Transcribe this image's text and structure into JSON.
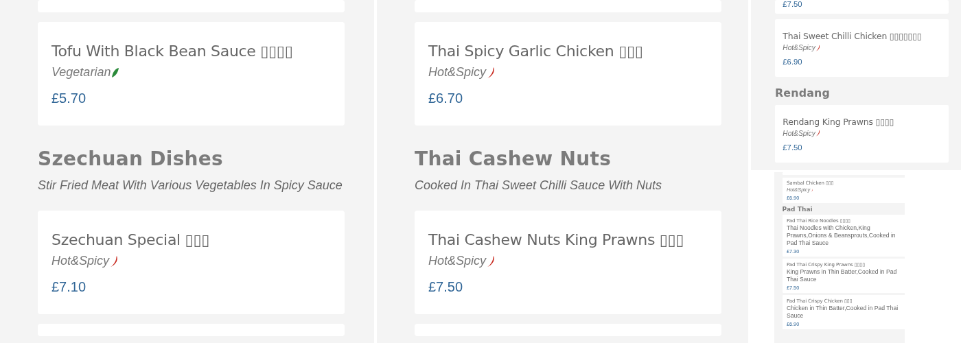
{
  "panels": [
    {
      "kind": "large",
      "items": [
        {
          "kind": "cut-card"
        },
        {
          "kind": "card",
          "name": "Tofu With Black Bean Sauce ▯▯▯▯",
          "tag": {
            "text": "Vegetarian",
            "kind": "leaf"
          },
          "price": "£5.70"
        },
        {
          "kind": "section",
          "title": "Szechuan Dishes",
          "subtitle": "Stir Fried Meat With Various Vegetables In Spicy Sauce"
        },
        {
          "kind": "card",
          "name": "Szechuan Special ▯▯▯",
          "tag": {
            "text": "Hot&Spicy",
            "kind": "chili"
          },
          "price": "£7.10"
        },
        {
          "kind": "cut-card"
        }
      ]
    },
    {
      "kind": "large",
      "items": [
        {
          "kind": "cut-card"
        },
        {
          "kind": "card",
          "name": "Thai Spicy Garlic Chicken ▯▯▯",
          "tag": {
            "text": "Hot&Spicy",
            "kind": "chili"
          },
          "price": "£6.70"
        },
        {
          "kind": "section",
          "title": "Thai Cashew Nuts",
          "subtitle": "Cooked In Thai Sweet Chilli Sauce With Nuts"
        },
        {
          "kind": "card",
          "name": "Thai Cashew Nuts King Prawns ▯▯▯",
          "tag": {
            "text": "Hot&Spicy",
            "kind": "chili"
          },
          "price": "£7.50"
        },
        {
          "kind": "cut-card"
        }
      ]
    },
    {
      "kind": "medium",
      "items": [
        {
          "kind": "price-end",
          "price": "£7.50"
        },
        {
          "kind": "card",
          "name": "Thai Sweet Chilli Chicken ▯▯▯▯▯▯▯",
          "tag": {
            "text": "Hot&Spicy",
            "kind": "chili"
          },
          "price": "£6.90"
        },
        {
          "kind": "section",
          "title": "Rendang"
        },
        {
          "kind": "card",
          "name": "Rendang King Prawns ▯▯▯▯",
          "tag": {
            "text": "Hot&Spicy",
            "kind": "chili"
          },
          "price": "£7.50"
        }
      ]
    },
    {
      "kind": "small",
      "items": [
        {
          "kind": "cut-card"
        },
        {
          "kind": "card",
          "name": "Sambal Chicken ▯▯▯",
          "tag": {
            "text": "Hot&Spicy",
            "kind": "chili"
          },
          "price": "£6.90"
        },
        {
          "kind": "section",
          "title": "Pad Thai"
        },
        {
          "kind": "card",
          "name": "Pad Thai Rice Noodles ▯▯▯▯",
          "description": "Thai Noodles with Chicken,King Prawns,Onions & Beansprouts,Cooked in Pad Thai Sauce",
          "price": "£7.30"
        },
        {
          "kind": "card",
          "name": "Pad Thai Crispy King Prawns ▯▯▯▯",
          "description": "King Prawns in Thin Batter,Cooked in Pad Thai Sauce",
          "price": "£7.50"
        },
        {
          "kind": "card",
          "name": "Pad Thai Crispy Chicken ▯▯▯",
          "description": "Chicken in Thin Batter,Cooked in Pad Thai Sauce",
          "price": "£6.90"
        }
      ]
    }
  ]
}
